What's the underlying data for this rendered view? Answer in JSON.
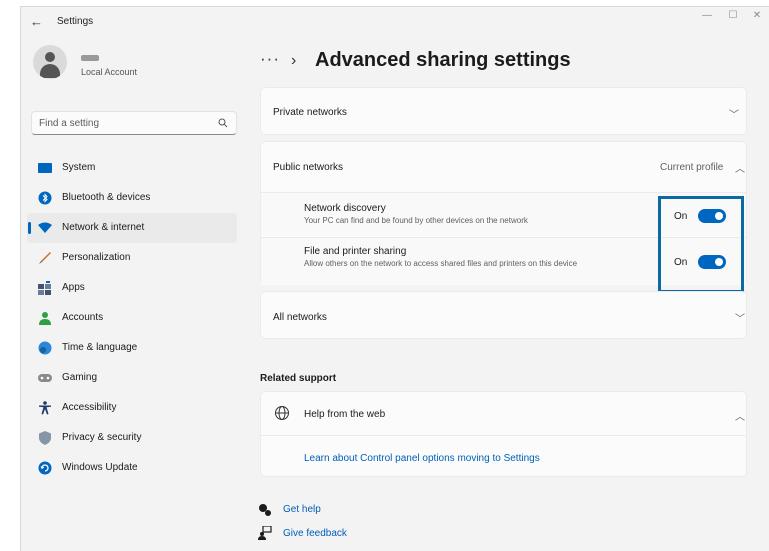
{
  "window": {
    "title": "Settings",
    "minimize": "—",
    "maximize": "☐",
    "close": "✕",
    "back": "←"
  },
  "profile": {
    "account_type": "Local Account"
  },
  "search": {
    "placeholder": "Find a setting"
  },
  "sidebar": {
    "items": [
      {
        "label": "System",
        "icon": "system-icon",
        "color": "#0067c0"
      },
      {
        "label": "Bluetooth & devices",
        "icon": "bluetooth-icon",
        "color": "#0067c0"
      },
      {
        "label": "Network & internet",
        "icon": "wifi-icon",
        "color": "#0067c0",
        "active": true
      },
      {
        "label": "Personalization",
        "icon": "brush-icon",
        "color": "#c86a2e"
      },
      {
        "label": "Apps",
        "icon": "apps-icon",
        "color": "#44546a"
      },
      {
        "label": "Accounts",
        "icon": "accounts-icon",
        "color": "#2ea043"
      },
      {
        "label": "Time & language",
        "icon": "globe-clock-icon",
        "color": "#2b88d8"
      },
      {
        "label": "Gaming",
        "icon": "gamepad-icon",
        "color": "#7a7a7a"
      },
      {
        "label": "Accessibility",
        "icon": "accessibility-icon",
        "color": "#1b3a6b"
      },
      {
        "label": "Privacy & security",
        "icon": "shield-icon",
        "color": "#7f8c9a"
      },
      {
        "label": "Windows Update",
        "icon": "update-icon",
        "color": "#0067c0"
      }
    ]
  },
  "breadcrumb": {
    "more": "···",
    "separator": "›",
    "title": "Advanced sharing settings"
  },
  "sections": {
    "private": {
      "label": "Private networks"
    },
    "public": {
      "label": "Public networks",
      "status": "Current profile",
      "settings": [
        {
          "title": "Network discovery",
          "description": "Your PC can find and be found by other devices on the network",
          "state": "On"
        },
        {
          "title": "File and printer sharing",
          "description": "Allow others on the network to access shared files and printers on this device",
          "state": "On"
        }
      ]
    },
    "all": {
      "label": "All networks"
    }
  },
  "related": {
    "heading": "Related support",
    "help_title": "Help from the web",
    "link": "Learn about Control panel options moving to Settings"
  },
  "footer": {
    "get_help": "Get help",
    "give_feedback": "Give feedback"
  },
  "colors": {
    "accent": "#0067c0",
    "highlight_border": "#0b6aa3"
  }
}
